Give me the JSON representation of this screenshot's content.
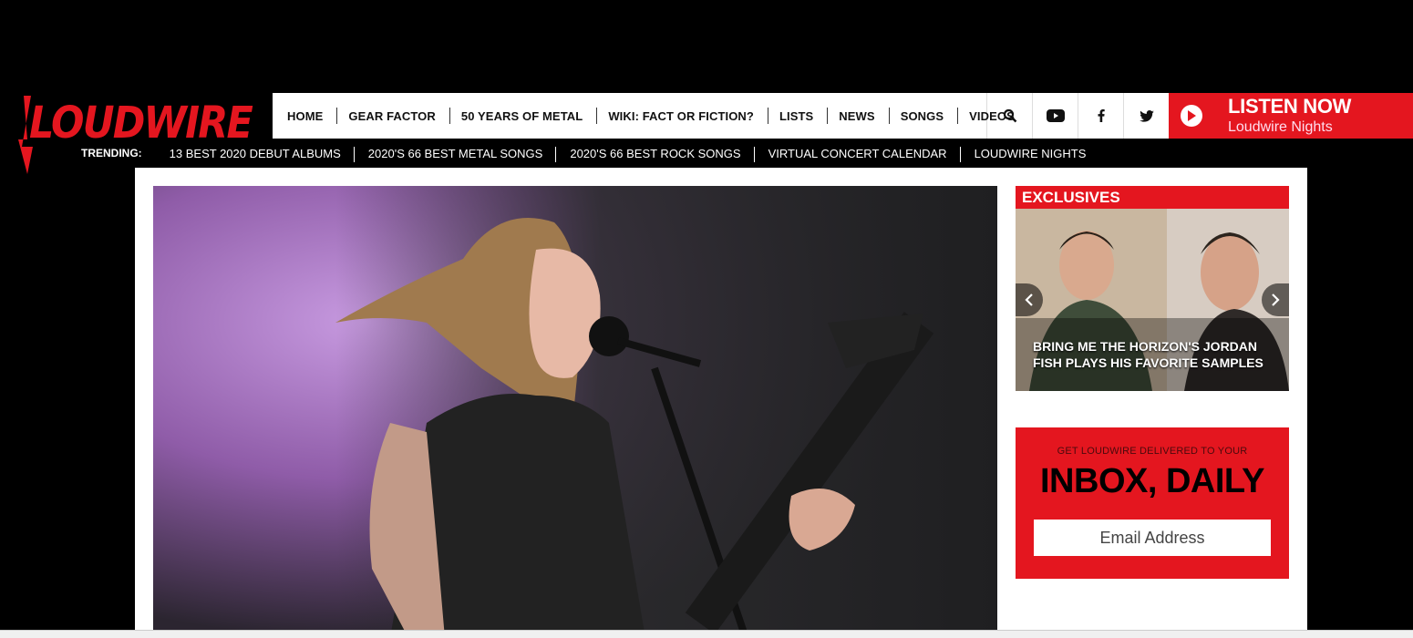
{
  "logo": {
    "text": "LOUDWIRE"
  },
  "nav": {
    "items": [
      {
        "label": "HOME"
      },
      {
        "label": "GEAR FACTOR"
      },
      {
        "label": "50 YEARS OF METAL"
      },
      {
        "label": "WIKI: FACT OR FICTION?"
      },
      {
        "label": "LISTS"
      },
      {
        "label": "NEWS"
      },
      {
        "label": "SONGS"
      },
      {
        "label": "VIDEOS"
      }
    ],
    "icons": [
      "search-icon",
      "youtube-icon",
      "facebook-icon",
      "twitter-icon"
    ]
  },
  "listen": {
    "title": "LISTEN NOW",
    "subtitle": "Loudwire Nights"
  },
  "trending": {
    "label": "TRENDING:",
    "items": [
      {
        "label": "13 BEST 2020 DEBUT ALBUMS"
      },
      {
        "label": "2020'S 66 BEST METAL SONGS"
      },
      {
        "label": "2020'S 66 BEST ROCK SONGS"
      },
      {
        "label": "VIRTUAL CONCERT CALENDAR"
      },
      {
        "label": "LOUDWIRE NIGHTS"
      }
    ]
  },
  "exclusives": {
    "heading": "EXCLUSIVES",
    "caption": "BRING ME THE HORIZON'S JORDAN FISH PLAYS HIS FAVORITE SAMPLES"
  },
  "newsletter": {
    "pre": "GET LOUDWIRE DELIVERED TO YOUR",
    "title": "INBOX, DAILY",
    "placeholder": "Email Address"
  },
  "colors": {
    "brand_red": "#e4161f",
    "background": "#000000"
  }
}
